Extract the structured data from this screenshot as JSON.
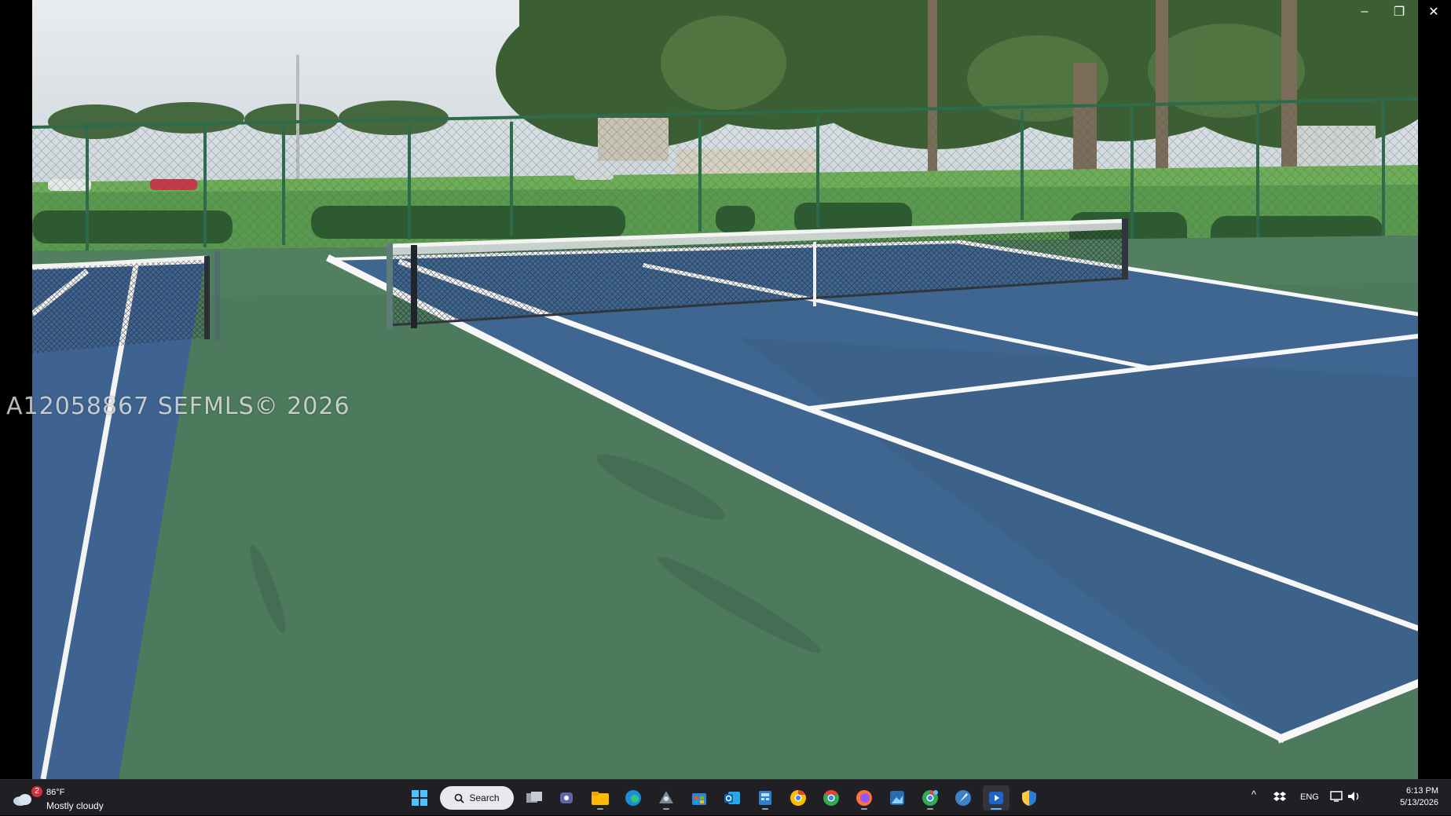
{
  "viewer": {
    "window_controls": {
      "minimize": "–",
      "restore": "❐",
      "close": "✕"
    },
    "watermark": "A12058867  SEFMLS© 2026",
    "photo_subject": "outdoor-tennis-courts"
  },
  "taskbar": {
    "weather": {
      "badge": "2",
      "temp": "86°F",
      "condition": "Mostly cloudy"
    },
    "search_label": "Search",
    "pinned_apps": [
      "windows-start-icon",
      "search-box",
      "task-view-icon",
      "teams-icon",
      "file-explorer-icon",
      "edge-icon",
      "network-app-icon",
      "store-icon",
      "outlook-icon",
      "calculator-app-icon",
      "chrome-alt-icon",
      "chrome-icon",
      "firefox-icon",
      "photos-icon",
      "chrome-profile-icon",
      "feather-app-icon",
      "media-player-icon",
      "security-shield-icon"
    ],
    "tray": {
      "chevron": "^",
      "language": "ENG",
      "time": "6:13 PM",
      "date": "5/13/2026"
    }
  },
  "colors": {
    "court_blue": "#3f6690",
    "court_green": "#4d7a5c",
    "taskbar_bg": "#1f1f24",
    "accent": "#4cc2ff"
  }
}
